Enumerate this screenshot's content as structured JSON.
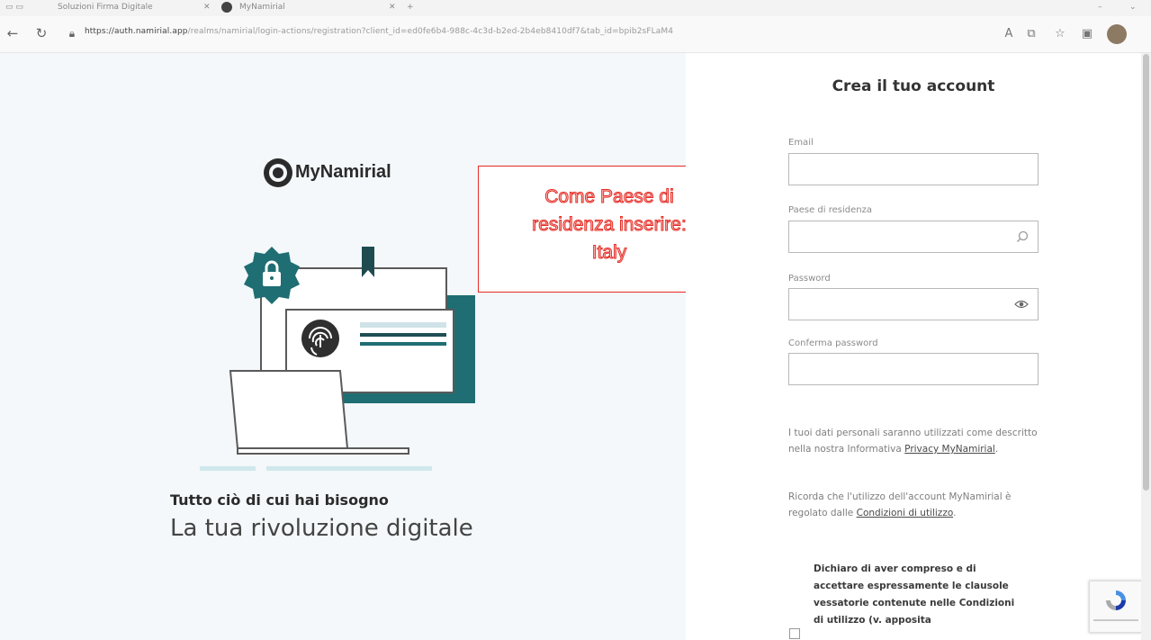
{
  "browser": {
    "tabs": [
      {
        "label": "Soluzioni Firma Digitale"
      },
      {
        "label": "MyNamirial"
      }
    ],
    "url_domain": "https://auth.namirial.app",
    "url_rest": "/realms/namirial/login-actions/registration?client_id=ed0fe6b4-988c-4c3d-b2ed-2b4eb8410df7&tab_id=bpib2sFLaM4"
  },
  "left": {
    "brand": "MyNamirial",
    "tagline": "Tutto ciò di cui hai bisogno",
    "headline": "La tua rivoluzione digitale"
  },
  "annotation": {
    "lines": [
      "Come Paese di",
      "residenza inserire:",
      "Italy"
    ]
  },
  "form": {
    "title": "Crea il tuo account",
    "email_label": "Email",
    "email_value": "",
    "country_label": "Paese di residenza",
    "country_value": "",
    "password_label": "Password",
    "password_value": "",
    "confirm_label": "Conferma password",
    "confirm_value": "",
    "privacy_text": "I tuoi dati personali saranno utilizzati come descritto nella nostra Informativa ",
    "privacy_link": "Privacy MyNamirial",
    "terms_text": "Ricorda che l'utilizzo dell'account MyNamirial è regolato dalle ",
    "terms_link": "Condizioni di utilizzo",
    "consent_text": "Dichiaro di aver compreso e di accettare espressamente le clausole vessatorie contenute nelle Condizioni di utilizzo (v. apposita",
    "consent_checked": false
  },
  "colors": {
    "teal": "#1f6e73",
    "dark_teal": "#1b4d52",
    "annotation_red": "#e52b24",
    "panel_bg": "#f4f8fa"
  }
}
